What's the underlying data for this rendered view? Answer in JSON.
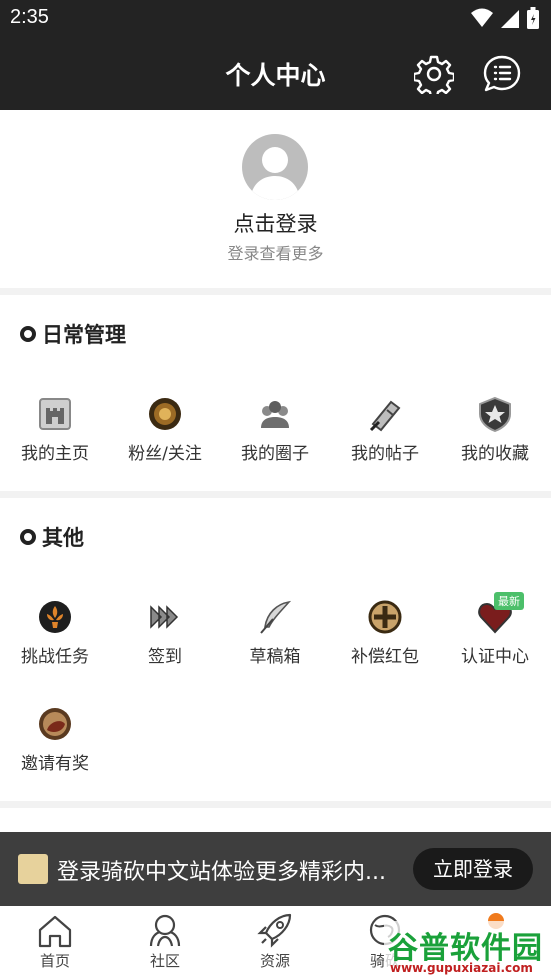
{
  "status_bar": {
    "time": "2:35"
  },
  "header": {
    "title": "个人中心",
    "settings_icon": "gear-icon",
    "message_icon": "chat-list-icon"
  },
  "profile": {
    "login_title": "点击登录",
    "login_subtitle": "登录查看更多"
  },
  "daily": {
    "title": "日常管理",
    "items": [
      {
        "label": "我的主页",
        "icon": "castle-icon"
      },
      {
        "label": "粉丝/关注",
        "icon": "lion-medallion-icon"
      },
      {
        "label": "我的圈子",
        "icon": "group-helmets-icon"
      },
      {
        "label": "我的帖子",
        "icon": "scroll-quill-icon"
      },
      {
        "label": "我的收藏",
        "icon": "star-shield-icon"
      }
    ]
  },
  "other": {
    "title": "其他",
    "items": [
      {
        "label": "挑战任务",
        "icon": "fleur-de-lis-icon"
      },
      {
        "label": "签到",
        "icon": "fast-forward-arrows-icon"
      },
      {
        "label": "草稿箱",
        "icon": "feather-icon"
      },
      {
        "label": "补偿红包",
        "icon": "cross-circle-icon"
      },
      {
        "label": "认证中心",
        "icon": "heart-badge-icon",
        "badge": "最新"
      },
      {
        "label": "邀请有奖",
        "icon": "gift-portrait-icon"
      }
    ]
  },
  "banner": {
    "message": "登录骑砍中文站体验更多精彩内...",
    "cta": "立即登录"
  },
  "tabbar": {
    "items": [
      {
        "label": "首页",
        "icon": "home-icon"
      },
      {
        "label": "社区",
        "icon": "community-icon"
      },
      {
        "label": "资源",
        "icon": "rocket-icon"
      },
      {
        "label": "骑砍",
        "icon": "globe-icon"
      },
      {
        "label": "",
        "icon": "profile-icon"
      }
    ]
  },
  "watermark": {
    "line1": "谷普软件园",
    "line2": "www.gupuxiazai.com"
  },
  "colors": {
    "dark_bar": "#232323",
    "banner_bg": "#3e3e3e",
    "accent_orange": "#f07a1d",
    "badge_green": "#4cbf6a"
  }
}
